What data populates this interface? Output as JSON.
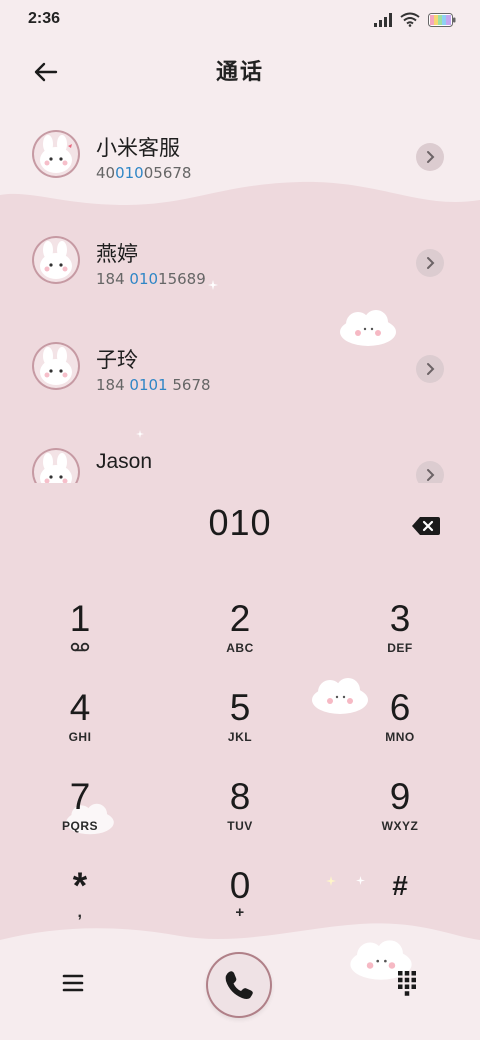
{
  "status": {
    "time": "2:36"
  },
  "header": {
    "title": "通话"
  },
  "contacts": [
    {
      "name": "小米客服",
      "number_parts": [
        "40",
        "010",
        "05678"
      ]
    },
    {
      "name": "燕婷",
      "number_parts": [
        "184 ",
        "010",
        "15689"
      ]
    },
    {
      "name": "子玲",
      "number_parts": [
        "184 ",
        "0101",
        " 5678"
      ]
    },
    {
      "name": "Jason",
      "number_parts": [
        "",
        "",
        ""
      ]
    }
  ],
  "dialer": {
    "input": "010",
    "keys": [
      {
        "digit": "1",
        "letters": ""
      },
      {
        "digit": "2",
        "letters": "ABC"
      },
      {
        "digit": "3",
        "letters": "DEF"
      },
      {
        "digit": "4",
        "letters": "GHI"
      },
      {
        "digit": "5",
        "letters": "JKL"
      },
      {
        "digit": "6",
        "letters": "MNO"
      },
      {
        "digit": "7",
        "letters": "PQRS"
      },
      {
        "digit": "8",
        "letters": "TUV"
      },
      {
        "digit": "9",
        "letters": "WXYZ"
      },
      {
        "digit": "*",
        "letters": ","
      },
      {
        "digit": "0",
        "letters": "+"
      },
      {
        "digit": "#",
        "letters": ""
      }
    ]
  },
  "icons": {
    "back": "arrow-left-icon",
    "backspace": "backspace-icon",
    "voicemail": "voicemail-icon",
    "menu": "menu-icon",
    "call": "phone-icon",
    "keypad": "dialpad-icon"
  },
  "colors": {
    "accent": "#2f86c6",
    "background": "#eed9dd",
    "panel": "#f6ecee"
  }
}
